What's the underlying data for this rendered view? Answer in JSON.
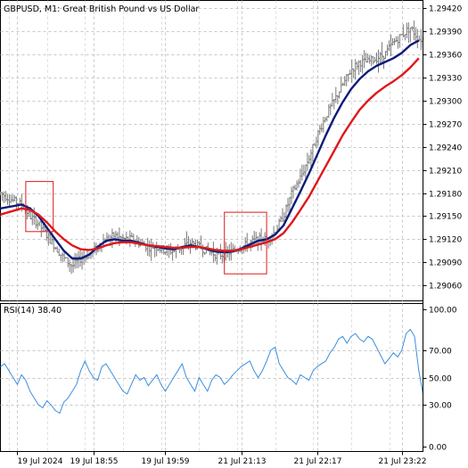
{
  "header": {
    "symbol_title": "GBPUSD, M1:  Great British Pound vs US Dollar"
  },
  "colors": {
    "background": "#ffffff",
    "grid": "#c8c8c8",
    "frame": "#000000",
    "price_bars": "#7a7a7a",
    "ma_fast": "#0b1c7a",
    "ma_slow": "#e0181b",
    "rsi_line": "#3d8fe0",
    "highlight_box": "#e0181b"
  },
  "chart_data": [
    {
      "type": "line",
      "title": "GBPUSD, M1:  Great British Pound vs US Dollar",
      "y_axis_position": "right",
      "grid": true,
      "ylim": [
        1.2904,
        1.2943
      ],
      "y_ticks": [
        "1.29420",
        "1.29390",
        "1.29360",
        "1.29330",
        "1.29300",
        "1.29270",
        "1.29240",
        "1.29210",
        "1.29180",
        "1.29150",
        "1.29120",
        "1.29090",
        "1.29060"
      ],
      "x_ticks": [
        "19 Jul 2024",
        "19 Jul 18:55",
        "19 Jul 19:59",
        "21 Jul 21:13",
        "21 Jul 22:17",
        "21 Jul 23:22"
      ],
      "t_range": [
        0,
        100
      ],
      "x_tick_positions": [
        4,
        22,
        39,
        57,
        75,
        95
      ],
      "price_points": [
        [
          0,
          1.2918
        ],
        [
          3,
          1.2917
        ],
        [
          5,
          1.29165
        ],
        [
          7,
          1.2915
        ],
        [
          9,
          1.2914
        ],
        [
          11,
          1.29125
        ],
        [
          13,
          1.2911
        ],
        [
          15,
          1.29095
        ],
        [
          17,
          1.29085
        ],
        [
          19,
          1.29095
        ],
        [
          21,
          1.291
        ],
        [
          23,
          1.2911
        ],
        [
          25,
          1.2912
        ],
        [
          27,
          1.29125
        ],
        [
          29,
          1.2912
        ],
        [
          31,
          1.2912
        ],
        [
          33,
          1.29115
        ],
        [
          35,
          1.2911
        ],
        [
          37,
          1.2911
        ],
        [
          39,
          1.29105
        ],
        [
          41,
          1.29105
        ],
        [
          43,
          1.2911
        ],
        [
          45,
          1.29115
        ],
        [
          47,
          1.2911
        ],
        [
          49,
          1.29105
        ],
        [
          51,
          1.291
        ],
        [
          53,
          1.291
        ],
        [
          55,
          1.29105
        ],
        [
          57,
          1.2911
        ],
        [
          59,
          1.29115
        ],
        [
          61,
          1.2912
        ],
        [
          63,
          1.2912
        ],
        [
          65,
          1.2913
        ],
        [
          67,
          1.2915
        ],
        [
          69,
          1.2918
        ],
        [
          71,
          1.292
        ],
        [
          73,
          1.29225
        ],
        [
          75,
          1.29255
        ],
        [
          77,
          1.2928
        ],
        [
          79,
          1.293
        ],
        [
          81,
          1.2932
        ],
        [
          83,
          1.2934
        ],
        [
          85,
          1.2935
        ],
        [
          87,
          1.2935
        ],
        [
          89,
          1.29355
        ],
        [
          91,
          1.2936
        ],
        [
          93,
          1.29375
        ],
        [
          95,
          1.29385
        ],
        [
          97,
          1.29395
        ],
        [
          99,
          1.2938
        ]
      ],
      "series": [
        {
          "name": "",
          "color": "#0b1c7a",
          "points": [
            [
              0,
              1.2916
            ],
            [
              5,
              1.29165
            ],
            [
              7,
              1.2916
            ],
            [
              9,
              1.2915
            ],
            [
              11,
              1.29135
            ],
            [
              13,
              1.2912
            ],
            [
              15,
              1.29105
            ],
            [
              17,
              1.29095
            ],
            [
              19,
              1.29095
            ],
            [
              21,
              1.291
            ],
            [
              23,
              1.2911
            ],
            [
              25,
              1.29118
            ],
            [
              27,
              1.2912
            ],
            [
              29,
              1.29118
            ],
            [
              31,
              1.29118
            ],
            [
              33,
              1.29115
            ],
            [
              35,
              1.29112
            ],
            [
              37,
              1.2911
            ],
            [
              39,
              1.29108
            ],
            [
              41,
              1.29107
            ],
            [
              43,
              1.2911
            ],
            [
              45,
              1.29112
            ],
            [
              47,
              1.2911
            ],
            [
              49,
              1.29107
            ],
            [
              51,
              1.29104
            ],
            [
              53,
              1.29103
            ],
            [
              55,
              1.29104
            ],
            [
              57,
              1.29108
            ],
            [
              59,
              1.29113
            ],
            [
              61,
              1.29118
            ],
            [
              63,
              1.2912
            ],
            [
              65,
              1.29126
            ],
            [
              67,
              1.29138
            ],
            [
              69,
              1.2916
            ],
            [
              71,
              1.29182
            ],
            [
              73,
              1.29205
            ],
            [
              75,
              1.2923
            ],
            [
              77,
              1.29255
            ],
            [
              79,
              1.29278
            ],
            [
              81,
              1.29298
            ],
            [
              83,
              1.29315
            ],
            [
              85,
              1.29328
            ],
            [
              87,
              1.29338
            ],
            [
              89,
              1.29345
            ],
            [
              91,
              1.2935
            ],
            [
              93,
              1.29355
            ],
            [
              95,
              1.29362
            ],
            [
              97,
              1.29372
            ],
            [
              99,
              1.29378
            ]
          ]
        },
        {
          "name": "",
          "color": "#e0181b",
          "points": [
            [
              0,
              1.29152
            ],
            [
              5,
              1.2916
            ],
            [
              7,
              1.29158
            ],
            [
              9,
              1.29152
            ],
            [
              11,
              1.29142
            ],
            [
              13,
              1.2913
            ],
            [
              15,
              1.2912
            ],
            [
              17,
              1.29112
            ],
            [
              19,
              1.29107
            ],
            [
              21,
              1.29106
            ],
            [
              23,
              1.29108
            ],
            [
              25,
              1.29112
            ],
            [
              27,
              1.29115
            ],
            [
              29,
              1.29116
            ],
            [
              31,
              1.29116
            ],
            [
              33,
              1.29114
            ],
            [
              35,
              1.29112
            ],
            [
              37,
              1.29111
            ],
            [
              39,
              1.2911
            ],
            [
              41,
              1.29109
            ],
            [
              43,
              1.29109
            ],
            [
              45,
              1.2911
            ],
            [
              47,
              1.2911
            ],
            [
              49,
              1.29108
            ],
            [
              51,
              1.29106
            ],
            [
              53,
              1.29105
            ],
            [
              55,
              1.29105
            ],
            [
              57,
              1.29107
            ],
            [
              59,
              1.2911
            ],
            [
              61,
              1.29113
            ],
            [
              63,
              1.29116
            ],
            [
              65,
              1.2912
            ],
            [
              67,
              1.29128
            ],
            [
              69,
              1.29142
            ],
            [
              71,
              1.29158
            ],
            [
              73,
              1.29175
            ],
            [
              75,
              1.29195
            ],
            [
              77,
              1.29215
            ],
            [
              79,
              1.29235
            ],
            [
              81,
              1.29255
            ],
            [
              83,
              1.29272
            ],
            [
              85,
              1.29288
            ],
            [
              87,
              1.293
            ],
            [
              89,
              1.2931
            ],
            [
              91,
              1.29318
            ],
            [
              93,
              1.29325
            ],
            [
              95,
              1.29333
            ],
            [
              97,
              1.29343
            ],
            [
              99,
              1.29355
            ]
          ]
        }
      ],
      "highlight_boxes": [
        {
          "t_range": [
            6,
            12.5
          ],
          "y_range": [
            1.2913,
            1.29195
          ]
        },
        {
          "t_range": [
            53,
            63
          ],
          "y_range": [
            1.29075,
            1.29155
          ]
        }
      ]
    },
    {
      "type": "line",
      "title": "RSI(14) 38.40",
      "y_axis_position": "right",
      "grid": true,
      "ylim": [
        0,
        100
      ],
      "y_ticks": [
        "100.00",
        "70.00",
        "50.00",
        "30.00",
        "0.00"
      ],
      "t_range": [
        0,
        100
      ],
      "series": [
        {
          "name": "RSI(14)",
          "color": "#3d8fe0",
          "points": [
            [
              0,
              58
            ],
            [
              1,
              60
            ],
            [
              2,
              55
            ],
            [
              3,
              50
            ],
            [
              4,
              45
            ],
            [
              5,
              52
            ],
            [
              6,
              48
            ],
            [
              7,
              40
            ],
            [
              8,
              35
            ],
            [
              9,
              30
            ],
            [
              10,
              28
            ],
            [
              11,
              33
            ],
            [
              12,
              30
            ],
            [
              13,
              26
            ],
            [
              14,
              24
            ],
            [
              15,
              32
            ],
            [
              16,
              35
            ],
            [
              17,
              40
            ],
            [
              18,
              45
            ],
            [
              19,
              55
            ],
            [
              20,
              62
            ],
            [
              21,
              55
            ],
            [
              22,
              50
            ],
            [
              23,
              48
            ],
            [
              24,
              58
            ],
            [
              25,
              60
            ],
            [
              26,
              55
            ],
            [
              27,
              50
            ],
            [
              28,
              45
            ],
            [
              29,
              40
            ],
            [
              30,
              38
            ],
            [
              31,
              45
            ],
            [
              32,
              52
            ],
            [
              33,
              48
            ],
            [
              34,
              50
            ],
            [
              35,
              44
            ],
            [
              36,
              48
            ],
            [
              37,
              52
            ],
            [
              38,
              45
            ],
            [
              39,
              40
            ],
            [
              40,
              45
            ],
            [
              41,
              50
            ],
            [
              42,
              55
            ],
            [
              43,
              60
            ],
            [
              44,
              50
            ],
            [
              45,
              45
            ],
            [
              46,
              40
            ],
            [
              47,
              50
            ],
            [
              48,
              45
            ],
            [
              49,
              40
            ],
            [
              50,
              48
            ],
            [
              51,
              52
            ],
            [
              52,
              50
            ],
            [
              53,
              45
            ],
            [
              54,
              48
            ],
            [
              55,
              52
            ],
            [
              56,
              55
            ],
            [
              57,
              58
            ],
            [
              58,
              60
            ],
            [
              59,
              62
            ],
            [
              60,
              55
            ],
            [
              61,
              50
            ],
            [
              62,
              55
            ],
            [
              63,
              62
            ],
            [
              64,
              70
            ],
            [
              65,
              72
            ],
            [
              66,
              60
            ],
            [
              67,
              55
            ],
            [
              68,
              50
            ],
            [
              69,
              48
            ],
            [
              70,
              45
            ],
            [
              71,
              52
            ],
            [
              72,
              50
            ],
            [
              73,
              48
            ],
            [
              74,
              55
            ],
            [
              75,
              58
            ],
            [
              76,
              60
            ],
            [
              77,
              62
            ],
            [
              78,
              68
            ],
            [
              79,
              72
            ],
            [
              80,
              78
            ],
            [
              81,
              80
            ],
            [
              82,
              75
            ],
            [
              83,
              80
            ],
            [
              84,
              82
            ],
            [
              85,
              78
            ],
            [
              86,
              76
            ],
            [
              87,
              80
            ],
            [
              88,
              78
            ],
            [
              89,
              72
            ],
            [
              90,
              66
            ],
            [
              91,
              60
            ],
            [
              92,
              64
            ],
            [
              93,
              68
            ],
            [
              94,
              65
            ],
            [
              95,
              70
            ],
            [
              96,
              82
            ],
            [
              97,
              85
            ],
            [
              98,
              80
            ],
            [
              99,
              55
            ],
            [
              100,
              38
            ]
          ]
        }
      ]
    }
  ]
}
